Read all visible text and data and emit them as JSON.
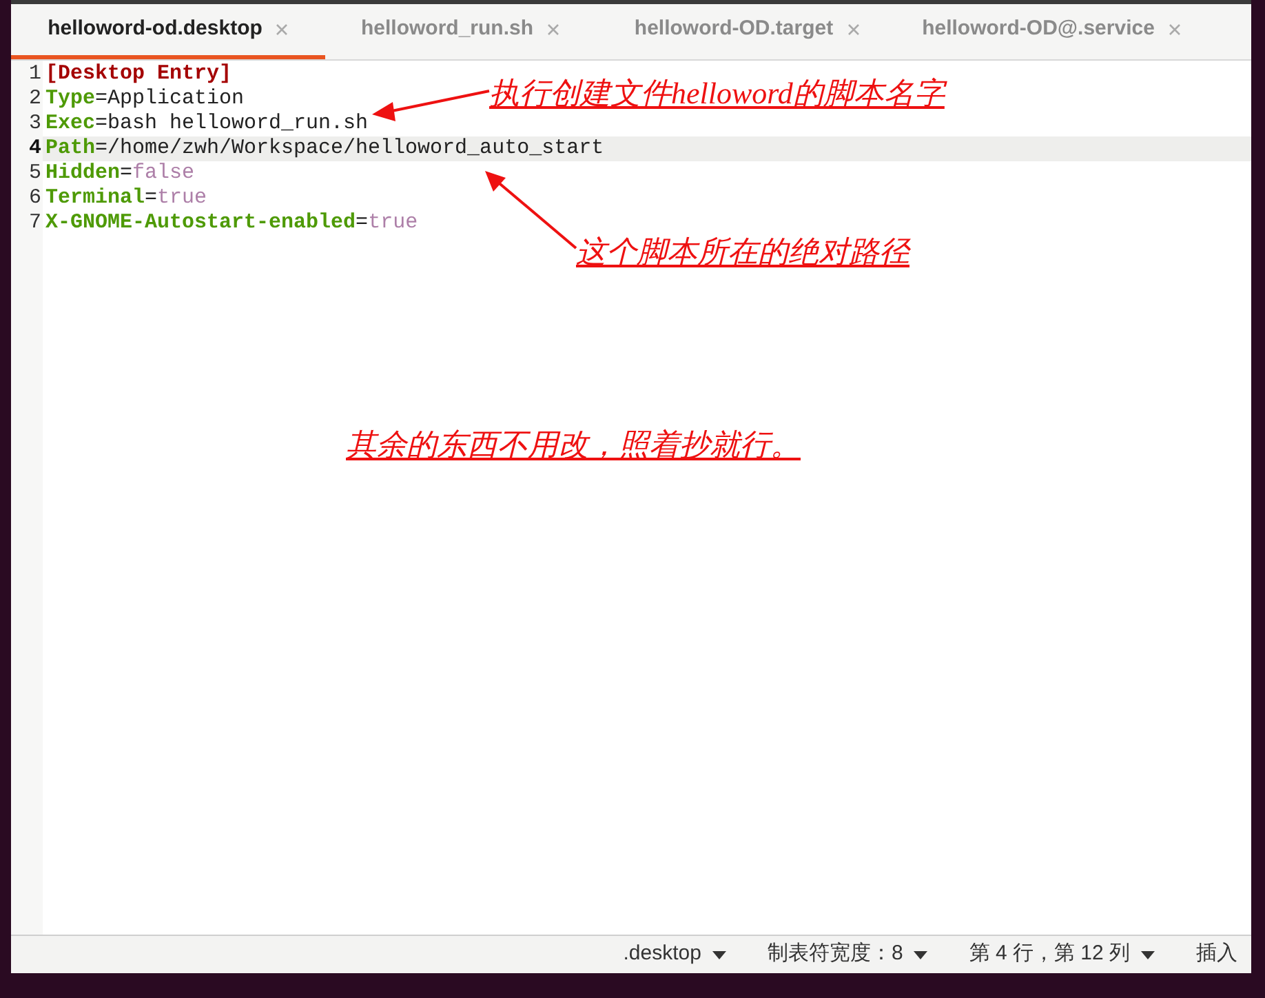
{
  "tabs": [
    {
      "label": "helloword-od.desktop",
      "selected": true
    },
    {
      "label": "helloword_run.sh",
      "selected": false
    },
    {
      "label": "helloword-OD.target",
      "selected": false
    },
    {
      "label": "helloword-OD@.service",
      "selected": false
    }
  ],
  "lines": [
    {
      "number": "1",
      "current": false,
      "tokens": [
        {
          "kind": "section",
          "text": "[Desktop Entry]"
        }
      ]
    },
    {
      "number": "2",
      "current": false,
      "tokens": [
        {
          "kind": "key",
          "text": "Type"
        },
        {
          "kind": "plain",
          "text": "=Application"
        }
      ]
    },
    {
      "number": "3",
      "current": false,
      "tokens": [
        {
          "kind": "key",
          "text": "Exec"
        },
        {
          "kind": "plain",
          "text": "=bash helloword_run.sh"
        }
      ]
    },
    {
      "number": "4",
      "current": true,
      "tokens": [
        {
          "kind": "key",
          "text": "Path"
        },
        {
          "kind": "plain",
          "text": "=/home/zwh/Workspace/helloword_auto_start"
        }
      ]
    },
    {
      "number": "5",
      "current": false,
      "tokens": [
        {
          "kind": "key",
          "text": "Hidden"
        },
        {
          "kind": "plain",
          "text": "="
        },
        {
          "kind": "bool",
          "text": "false"
        }
      ]
    },
    {
      "number": "6",
      "current": false,
      "tokens": [
        {
          "kind": "key",
          "text": "Terminal"
        },
        {
          "kind": "plain",
          "text": "="
        },
        {
          "kind": "bool",
          "text": "true"
        }
      ]
    },
    {
      "number": "7",
      "current": false,
      "tokens": [
        {
          "kind": "key",
          "text": "X-GNOME-Autostart-enabled"
        },
        {
          "kind": "plain",
          "text": "="
        },
        {
          "kind": "bool",
          "text": "true"
        }
      ]
    }
  ],
  "annotations": [
    "执行创建文件helloword的脚本名字",
    "这个脚本所在的绝对路径",
    "其余的东西不用改，照着抄就行。"
  ],
  "status_bar": [
    {
      "text": ".desktop",
      "dropdown": true
    },
    {
      "text": "制表符宽度：8",
      "dropdown": true
    },
    {
      "text": "第 4 行，第 12 列",
      "dropdown": true
    },
    {
      "text": "插入",
      "dropdown": false
    }
  ]
}
